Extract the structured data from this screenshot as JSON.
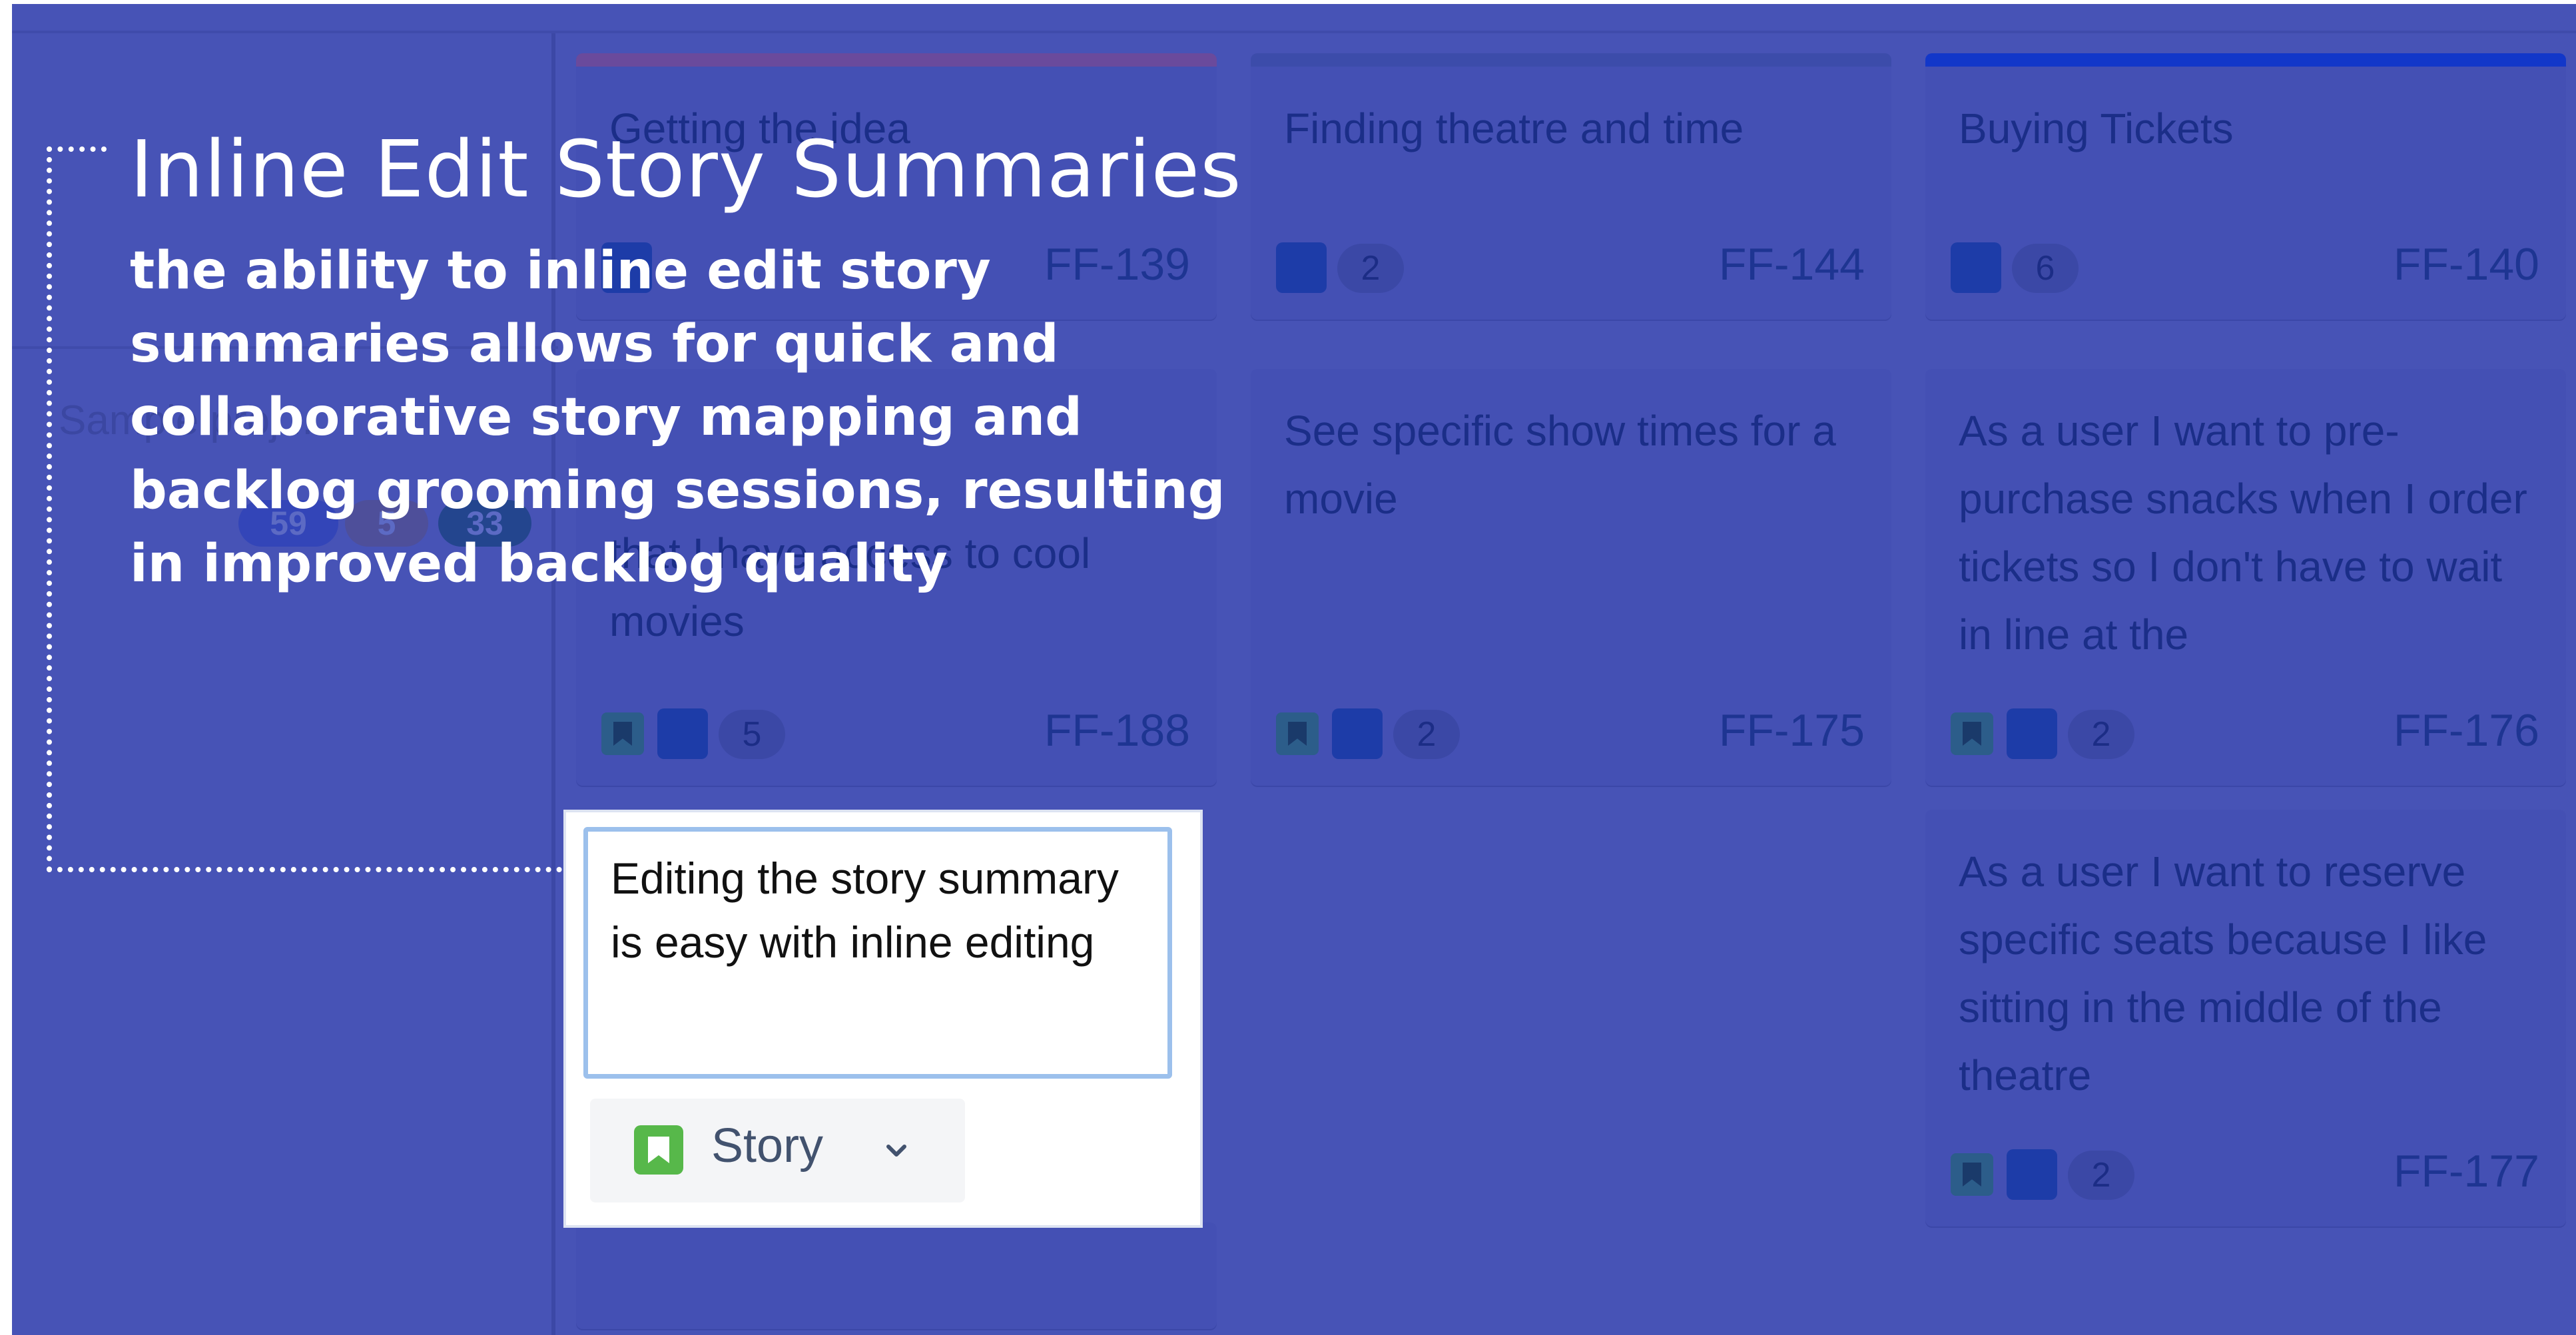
{
  "callout": {
    "title": "Inline Edit Story Summaries",
    "body": "the ability to inline edit story summaries allows for quick and collaborative story mapping and backlog grooming sessions, resulting in improved backlog quality"
  },
  "swimlane": {
    "label": "Sample proj...",
    "counts": [
      "59",
      "5",
      "33"
    ]
  },
  "colors": {
    "overlay": "#4753b6",
    "story_green": "#57b84a",
    "edit_focus": "#9cc0ec"
  },
  "epics": [
    {
      "summary": "Getting the idea",
      "count": "",
      "key": "FF-139",
      "stripe": "#6a4a9c"
    },
    {
      "summary": "Finding theatre and time",
      "count": "2",
      "key": "FF-144",
      "stripe": "#3c4caa"
    },
    {
      "summary": "Buying Tickets",
      "count": "6",
      "key": "FF-140",
      "stripe": "#1237c9"
    }
  ],
  "stories": [
    {
      "summary": "As a user I want to subscribe to Netflix so that I have access to cool movies",
      "visible_text": "that I have access to cool movies",
      "count": "5",
      "key": "FF-188"
    },
    {
      "summary": "See specific show times for a movie",
      "count": "2",
      "key": "FF-175"
    },
    {
      "summary": "As a user I want to pre-purchase snacks when I order tickets so I don't have to wait in line at the",
      "count": "2",
      "key": "FF-176"
    },
    {
      "summary": "As a user I want to reserve specific seats because I like sitting in the middle of the theatre",
      "count": "2",
      "key": "FF-177"
    }
  ],
  "editor": {
    "value": "Editing the story summary is easy with inline editing",
    "issue_type": "Story"
  }
}
